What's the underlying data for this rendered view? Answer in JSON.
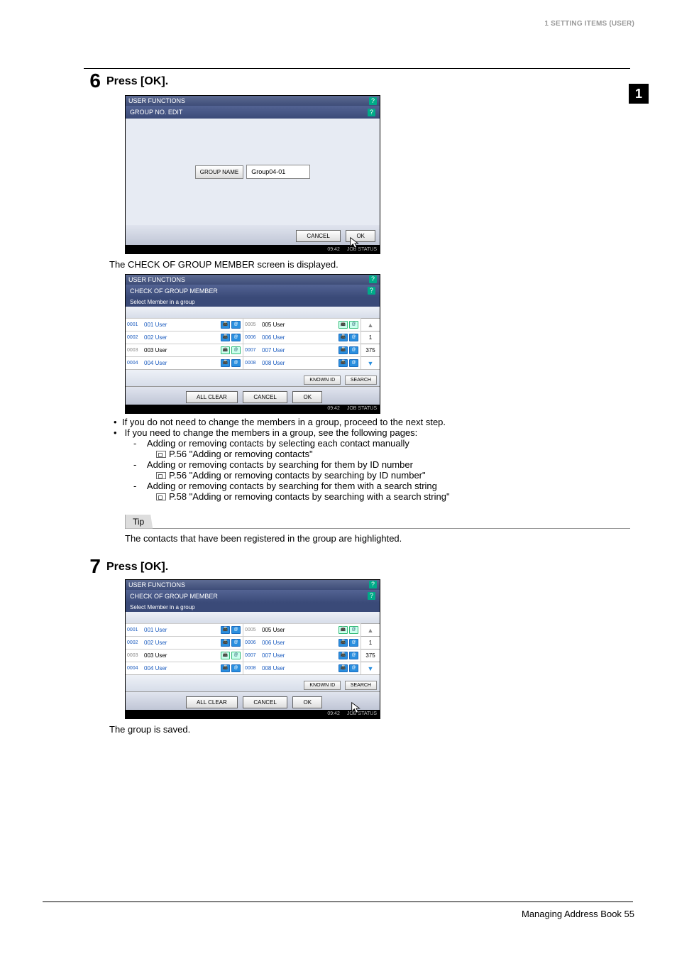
{
  "header": {
    "section": "1 SETTING ITEMS (USER)"
  },
  "side_tab": "1",
  "step6": {
    "num": "6",
    "title": "Press [OK].",
    "screen": {
      "top_title": "USER FUNCTIONS",
      "title": "GROUP NO. EDIT",
      "group_name_label": "GROUP NAME",
      "group_name_value": "Group04-01",
      "cancel": "CANCEL",
      "ok": "OK",
      "time": "09:42",
      "jobstatus": "JOB STATUS"
    },
    "after_text": "The CHECK OF GROUP MEMBER screen is displayed.",
    "memscreen": {
      "top_title": "USER FUNCTIONS",
      "title": "CHECK OF GROUP MEMBER",
      "instr": "Select Member in a group",
      "left": [
        {
          "id": "0001",
          "name": "001 User",
          "sel": true,
          "fax": true,
          "mail": true
        },
        {
          "id": "0002",
          "name": "002 User",
          "sel": true,
          "fax": true,
          "mail": true
        },
        {
          "id": "0003",
          "name": "003 User",
          "sel": false,
          "fax": false,
          "mail": false
        },
        {
          "id": "0004",
          "name": "004 User",
          "sel": true,
          "fax": true,
          "mail": true
        }
      ],
      "right": [
        {
          "id": "0005",
          "name": "005 User",
          "sel": false,
          "fax": false,
          "mail": false
        },
        {
          "id": "0006",
          "name": "006 User",
          "sel": true,
          "fax": true,
          "mail": true
        },
        {
          "id": "0007",
          "name": "007 User",
          "sel": true,
          "fax": true,
          "mail": true
        },
        {
          "id": "0008",
          "name": "008 User",
          "sel": true,
          "fax": true,
          "mail": true
        }
      ],
      "page_cur": "1",
      "page_total": "375",
      "known_id": "KNOWN ID",
      "search": "SEARCH",
      "all_clear": "ALL CLEAR",
      "cancel": "CANCEL",
      "ok": "OK",
      "time": "09:42",
      "jobstatus": "JOB STATUS"
    },
    "bullets": {
      "b1": "If you do not need to change the members in a group, proceed to the next step.",
      "b2": "If you need to change the members in a group, see the following pages:",
      "d1": "Adding or removing contacts by selecting each contact manually",
      "d1ref": "P.56 \"Adding or removing contacts\"",
      "d2": "Adding or removing contacts by searching for them by ID number",
      "d2ref": "P.56 \"Adding or removing contacts by searching by ID number\"",
      "d3": "Adding or removing contacts by searching for them with a search string",
      "d3ref": "P.58 \"Adding or removing contacts by searching with a search string\""
    },
    "tip_label": "Tip",
    "tip_text": "The contacts that have been registered in the group are highlighted."
  },
  "step7": {
    "num": "7",
    "title": "Press [OK].",
    "after_text": "The group is saved."
  },
  "footer": {
    "text": "Managing Address Book    55"
  }
}
